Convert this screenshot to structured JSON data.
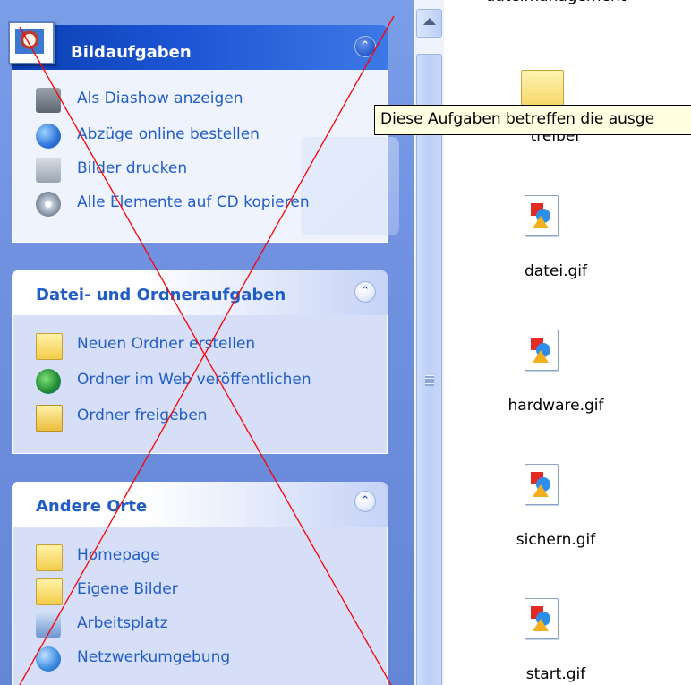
{
  "task_pane": {
    "picture_tasks": {
      "title": "Bildaufgaben",
      "items": [
        {
          "label": "Als Diashow anzeigen",
          "icon": "slideshow-icon"
        },
        {
          "label": "Abzüge online bestellen",
          "icon": "order-prints-icon"
        },
        {
          "label": "Bilder drucken",
          "icon": "printer-icon"
        },
        {
          "label": "Alle Elemente auf CD kopieren",
          "icon": "cd-copy-icon"
        }
      ]
    },
    "file_folder_tasks": {
      "title": "Datei- und Ordneraufgaben",
      "items": [
        {
          "label": "Neuen Ordner erstellen",
          "icon": "new-folder-icon"
        },
        {
          "label": "Ordner im Web veröffentlichen",
          "icon": "publish-web-icon"
        },
        {
          "label": "Ordner freigeben",
          "icon": "share-folder-icon"
        }
      ]
    },
    "other_places": {
      "title": "Andere Orte",
      "items": [
        {
          "label": "Homepage",
          "icon": "folder-icon"
        },
        {
          "label": "Eigene Bilder",
          "icon": "my-pictures-icon"
        },
        {
          "label": "Arbeitsplatz",
          "icon": "my-computer-icon"
        },
        {
          "label": "Netzwerkumgebung",
          "icon": "network-icon"
        }
      ]
    }
  },
  "tooltip": "Diese Aufgaben betreffen die ausge",
  "files": [
    {
      "name": "dateimanagement",
      "type": "folder"
    },
    {
      "name": "treiber",
      "type": "folder"
    },
    {
      "name": "datei.gif",
      "type": "gif"
    },
    {
      "name": "hardware.gif",
      "type": "gif"
    },
    {
      "name": "sichern.gif",
      "type": "gif"
    },
    {
      "name": "start.gif",
      "type": "gif"
    }
  ],
  "colors": {
    "link_blue": "#215dc6",
    "pane_background": "#6f8fdf",
    "overlay_cross": "#ff0000",
    "tooltip_background": "#ffffe1"
  }
}
